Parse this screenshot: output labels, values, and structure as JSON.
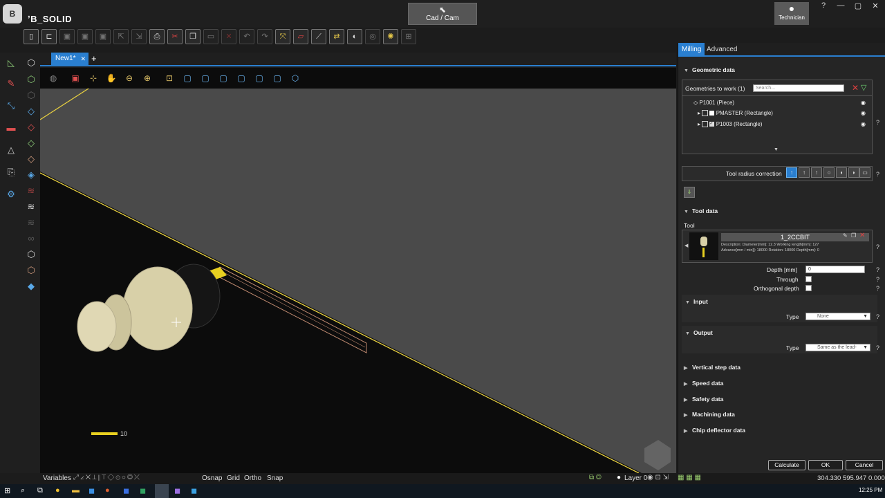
{
  "app": {
    "logo": "B",
    "title": "ʼB_SOLID",
    "mode_button": "Cad / Cam",
    "user": "Technician"
  },
  "window_controls": {
    "help": "?",
    "minimize": "—",
    "maximize": "▢",
    "close": "✕"
  },
  "doc_tabs": {
    "active": "New1*",
    "close": "✕",
    "add": "+"
  },
  "viewport": {
    "scale_label": "10"
  },
  "statusbar": {
    "variables": "Variables",
    "osnap": "Osnap",
    "grid": "Grid",
    "ortho": "Ortho",
    "snap": "Snap",
    "layer": "Layer 0",
    "coords": "304.330  595.947  0.000"
  },
  "taskbar": {
    "time": "12:25 PM"
  },
  "panel": {
    "tabs": [
      "Milling",
      "Advanced"
    ],
    "geometric": {
      "title": "Geometric data",
      "geometries_label": "Geometries to work (1)",
      "search_placeholder": "Search...",
      "tree": [
        {
          "label": "P1001 (Piece)"
        },
        {
          "label": "PMASTER (Rectangle)"
        },
        {
          "label": "P1003 (Rectangle)"
        }
      ]
    },
    "tool_radius_label": "Tool radius correction",
    "tool_data": {
      "title": "Tool data",
      "tool_label": "Tool",
      "tool_name": "1_2CCBIT",
      "desc_line1": "Description:  Diameter[mm]: 12.3  Working length[mm]: 127",
      "desc_line2": "Advance[mm / min]]: 18000  Rotation: 18000  Depth[mm]: 0",
      "depth_label": "Depth  [mm]",
      "depth_value": "0",
      "through_label": "Through",
      "orthogonal_label": "Orthogonal depth"
    },
    "input": {
      "title": "Input",
      "type_label": "Type",
      "type_value": "None"
    },
    "output": {
      "title": "Output",
      "type_label": "Type",
      "type_value": "Same as the lead-"
    },
    "collapsed_sections": [
      "Vertical step data",
      "Speed data",
      "Safety data",
      "Machining data",
      "Chip deflector data"
    ],
    "buttons": {
      "calculate": "Calculate",
      "ok": "OK",
      "cancel": "Cancel"
    },
    "help": "?"
  }
}
